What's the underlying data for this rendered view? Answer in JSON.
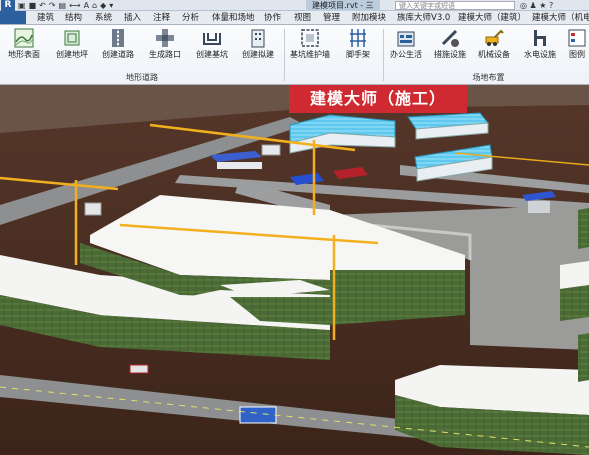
{
  "quick_access": {
    "logo": "R",
    "title": "建模项目.rvt - 三",
    "search_placeholder": "键入关键字或短语"
  },
  "tabs": [
    {
      "label": "建筑"
    },
    {
      "label": "结构"
    },
    {
      "label": "系统"
    },
    {
      "label": "插入"
    },
    {
      "label": "注释"
    },
    {
      "label": "分析"
    },
    {
      "label": "体量和场地"
    },
    {
      "label": "协作"
    },
    {
      "label": "视图"
    },
    {
      "label": "管理"
    },
    {
      "label": "附加模块"
    },
    {
      "label": "族库大师V3.0"
    },
    {
      "label": "建模大师（建筑）"
    },
    {
      "label": "建模大师（机电"
    }
  ],
  "ribbon": {
    "buttons": [
      {
        "label": "地形表面",
        "icon": "terrain-surface-icon"
      },
      {
        "label": "创建地坪",
        "icon": "create-floor-icon"
      },
      {
        "label": "创建道路",
        "icon": "create-road-icon"
      },
      {
        "label": "生成路口",
        "icon": "generate-intersection-icon"
      },
      {
        "label": "创建基坑",
        "icon": "create-pit-icon"
      },
      {
        "label": "创建拟建",
        "icon": "create-proposed-building-icon"
      },
      {
        "label": "基坑维护墙",
        "icon": "pit-retaining-wall-icon"
      },
      {
        "label": "脚手架",
        "icon": "scaffold-icon"
      },
      {
        "label": "办公生活",
        "icon": "office-living-icon"
      },
      {
        "label": "措施设施",
        "icon": "measure-facility-icon"
      },
      {
        "label": "机械设备",
        "icon": "mechanical-equipment-icon"
      },
      {
        "label": "水电设施",
        "icon": "water-electric-facility-icon"
      },
      {
        "label": "图例",
        "icon": "legend-icon"
      }
    ],
    "groups": [
      {
        "label": "地形道路"
      },
      {
        "label": "场地布置"
      }
    ]
  },
  "banner": {
    "text": "建模大师（施工）"
  },
  "colors": {
    "brand_blue": "#2b5f9e",
    "banner_red": "#cf2a31",
    "crane_yellow": "#f2b01e",
    "building_green": "#4b6a35",
    "ground_brown": "#4a2d22"
  }
}
